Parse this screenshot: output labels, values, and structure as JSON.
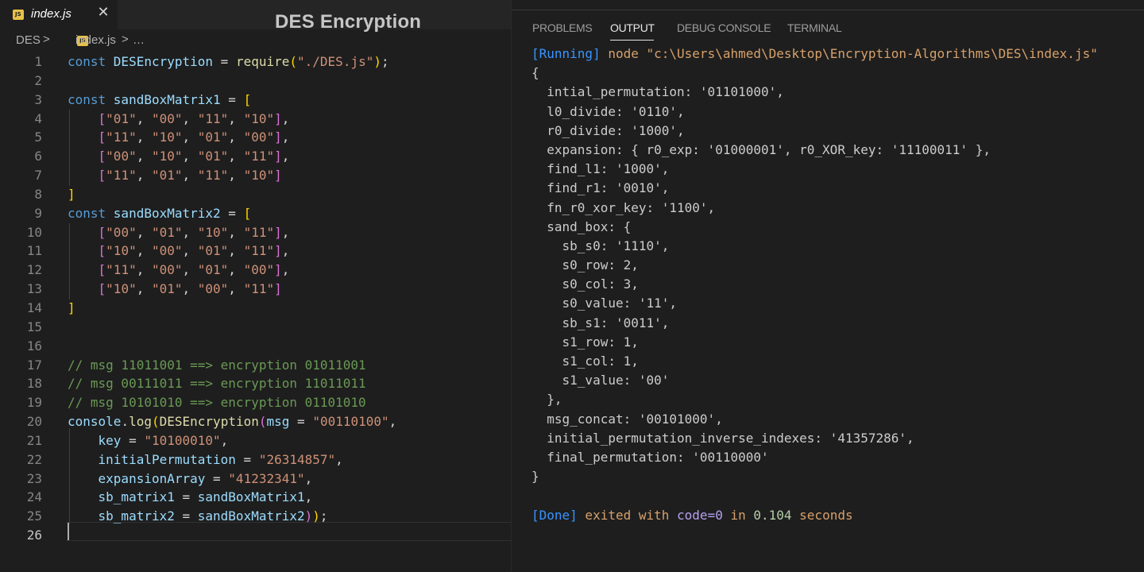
{
  "overlay_title": "DES Encryption",
  "editor": {
    "tab": {
      "label": "index.js",
      "icon": "js-file-icon",
      "close": "✕"
    },
    "breadcrumb": {
      "folder": "DES",
      "sep1": ">",
      "file": "index.js",
      "sep2": ">",
      "more": "…"
    },
    "lines": [
      {
        "n": "1",
        "segs": [
          {
            "t": "const ",
            "c": "k"
          },
          {
            "t": "DESEncryption",
            "c": "v"
          },
          {
            "t": " = ",
            "c": ""
          },
          {
            "t": "require",
            "c": "f"
          },
          {
            "t": "(",
            "c": "b1"
          },
          {
            "t": "\"./DES.js\"",
            "c": "s"
          },
          {
            "t": ")",
            "c": "b1"
          },
          {
            "t": ";",
            "c": ""
          }
        ]
      },
      {
        "n": "2",
        "segs": []
      },
      {
        "n": "3",
        "segs": [
          {
            "t": "const ",
            "c": "k"
          },
          {
            "t": "sandBoxMatrix1",
            "c": "v"
          },
          {
            "t": " = ",
            "c": ""
          },
          {
            "t": "[",
            "c": "b1"
          }
        ]
      },
      {
        "n": "4",
        "segs": [
          {
            "t": "    ",
            "c": ""
          },
          {
            "t": "[",
            "c": "b2"
          },
          {
            "t": "\"01\"",
            "c": "s"
          },
          {
            "t": ", ",
            "c": ""
          },
          {
            "t": "\"00\"",
            "c": "s"
          },
          {
            "t": ", ",
            "c": ""
          },
          {
            "t": "\"11\"",
            "c": "s"
          },
          {
            "t": ", ",
            "c": ""
          },
          {
            "t": "\"10\"",
            "c": "s"
          },
          {
            "t": "]",
            "c": "b2"
          },
          {
            "t": ",",
            "c": ""
          }
        ]
      },
      {
        "n": "5",
        "segs": [
          {
            "t": "    ",
            "c": ""
          },
          {
            "t": "[",
            "c": "b2"
          },
          {
            "t": "\"11\"",
            "c": "s"
          },
          {
            "t": ", ",
            "c": ""
          },
          {
            "t": "\"10\"",
            "c": "s"
          },
          {
            "t": ", ",
            "c": ""
          },
          {
            "t": "\"01\"",
            "c": "s"
          },
          {
            "t": ", ",
            "c": ""
          },
          {
            "t": "\"00\"",
            "c": "s"
          },
          {
            "t": "]",
            "c": "b2"
          },
          {
            "t": ",",
            "c": ""
          }
        ]
      },
      {
        "n": "6",
        "segs": [
          {
            "t": "    ",
            "c": ""
          },
          {
            "t": "[",
            "c": "b2"
          },
          {
            "t": "\"00\"",
            "c": "s"
          },
          {
            "t": ", ",
            "c": ""
          },
          {
            "t": "\"10\"",
            "c": "s"
          },
          {
            "t": ", ",
            "c": ""
          },
          {
            "t": "\"01\"",
            "c": "s"
          },
          {
            "t": ", ",
            "c": ""
          },
          {
            "t": "\"11\"",
            "c": "s"
          },
          {
            "t": "]",
            "c": "b2"
          },
          {
            "t": ",",
            "c": ""
          }
        ]
      },
      {
        "n": "7",
        "segs": [
          {
            "t": "    ",
            "c": ""
          },
          {
            "t": "[",
            "c": "b2"
          },
          {
            "t": "\"11\"",
            "c": "s"
          },
          {
            "t": ", ",
            "c": ""
          },
          {
            "t": "\"01\"",
            "c": "s"
          },
          {
            "t": ", ",
            "c": ""
          },
          {
            "t": "\"11\"",
            "c": "s"
          },
          {
            "t": ", ",
            "c": ""
          },
          {
            "t": "\"10\"",
            "c": "s"
          },
          {
            "t": "]",
            "c": "b2"
          }
        ]
      },
      {
        "n": "8",
        "segs": [
          {
            "t": "]",
            "c": "b1"
          }
        ]
      },
      {
        "n": "9",
        "segs": [
          {
            "t": "const ",
            "c": "k"
          },
          {
            "t": "sandBoxMatrix2",
            "c": "v"
          },
          {
            "t": " = ",
            "c": ""
          },
          {
            "t": "[",
            "c": "b1"
          }
        ]
      },
      {
        "n": "10",
        "segs": [
          {
            "t": "    ",
            "c": ""
          },
          {
            "t": "[",
            "c": "b2"
          },
          {
            "t": "\"00\"",
            "c": "s"
          },
          {
            "t": ", ",
            "c": ""
          },
          {
            "t": "\"01\"",
            "c": "s"
          },
          {
            "t": ", ",
            "c": ""
          },
          {
            "t": "\"10\"",
            "c": "s"
          },
          {
            "t": ", ",
            "c": ""
          },
          {
            "t": "\"11\"",
            "c": "s"
          },
          {
            "t": "]",
            "c": "b2"
          },
          {
            "t": ",",
            "c": ""
          }
        ]
      },
      {
        "n": "11",
        "segs": [
          {
            "t": "    ",
            "c": ""
          },
          {
            "t": "[",
            "c": "b2"
          },
          {
            "t": "\"10\"",
            "c": "s"
          },
          {
            "t": ", ",
            "c": ""
          },
          {
            "t": "\"00\"",
            "c": "s"
          },
          {
            "t": ", ",
            "c": ""
          },
          {
            "t": "\"01\"",
            "c": "s"
          },
          {
            "t": ", ",
            "c": ""
          },
          {
            "t": "\"11\"",
            "c": "s"
          },
          {
            "t": "]",
            "c": "b2"
          },
          {
            "t": ",",
            "c": ""
          }
        ]
      },
      {
        "n": "12",
        "segs": [
          {
            "t": "    ",
            "c": ""
          },
          {
            "t": "[",
            "c": "b2"
          },
          {
            "t": "\"11\"",
            "c": "s"
          },
          {
            "t": ", ",
            "c": ""
          },
          {
            "t": "\"00\"",
            "c": "s"
          },
          {
            "t": ", ",
            "c": ""
          },
          {
            "t": "\"01\"",
            "c": "s"
          },
          {
            "t": ", ",
            "c": ""
          },
          {
            "t": "\"00\"",
            "c": "s"
          },
          {
            "t": "]",
            "c": "b2"
          },
          {
            "t": ",",
            "c": ""
          }
        ]
      },
      {
        "n": "13",
        "segs": [
          {
            "t": "    ",
            "c": ""
          },
          {
            "t": "[",
            "c": "b2"
          },
          {
            "t": "\"10\"",
            "c": "s"
          },
          {
            "t": ", ",
            "c": ""
          },
          {
            "t": "\"01\"",
            "c": "s"
          },
          {
            "t": ", ",
            "c": ""
          },
          {
            "t": "\"00\"",
            "c": "s"
          },
          {
            "t": ", ",
            "c": ""
          },
          {
            "t": "\"11\"",
            "c": "s"
          },
          {
            "t": "]",
            "c": "b2"
          }
        ]
      },
      {
        "n": "14",
        "segs": [
          {
            "t": "]",
            "c": "b1"
          }
        ]
      },
      {
        "n": "15",
        "segs": []
      },
      {
        "n": "16",
        "segs": []
      },
      {
        "n": "17",
        "segs": [
          {
            "t": "// msg 11011001 ==> encryption 01011001",
            "c": "c"
          }
        ]
      },
      {
        "n": "18",
        "segs": [
          {
            "t": "// msg 00111011 ==> encryption 11011011",
            "c": "c"
          }
        ]
      },
      {
        "n": "19",
        "segs": [
          {
            "t": "// msg 10101010 ==> encryption 01101010",
            "c": "c"
          }
        ]
      },
      {
        "n": "20",
        "segs": [
          {
            "t": "console",
            "c": "v"
          },
          {
            "t": ".",
            "c": ""
          },
          {
            "t": "log",
            "c": "f"
          },
          {
            "t": "(",
            "c": "b1"
          },
          {
            "t": "DESEncryption",
            "c": "f"
          },
          {
            "t": "(",
            "c": "b2"
          },
          {
            "t": "msg",
            "c": "v"
          },
          {
            "t": " = ",
            "c": ""
          },
          {
            "t": "\"00110100\"",
            "c": "s"
          },
          {
            "t": ",",
            "c": ""
          }
        ]
      },
      {
        "n": "21",
        "segs": [
          {
            "t": "    ",
            "c": ""
          },
          {
            "t": "key",
            "c": "v"
          },
          {
            "t": " = ",
            "c": ""
          },
          {
            "t": "\"10100010\"",
            "c": "s"
          },
          {
            "t": ",",
            "c": ""
          }
        ]
      },
      {
        "n": "22",
        "segs": [
          {
            "t": "    ",
            "c": ""
          },
          {
            "t": "initialPermutation",
            "c": "v"
          },
          {
            "t": " = ",
            "c": ""
          },
          {
            "t": "\"26314857\"",
            "c": "s"
          },
          {
            "t": ",",
            "c": ""
          }
        ]
      },
      {
        "n": "23",
        "segs": [
          {
            "t": "    ",
            "c": ""
          },
          {
            "t": "expansionArray",
            "c": "v"
          },
          {
            "t": " = ",
            "c": ""
          },
          {
            "t": "\"41232341\"",
            "c": "s"
          },
          {
            "t": ",",
            "c": ""
          }
        ]
      },
      {
        "n": "24",
        "segs": [
          {
            "t": "    ",
            "c": ""
          },
          {
            "t": "sb_matrix1",
            "c": "v"
          },
          {
            "t": " = ",
            "c": ""
          },
          {
            "t": "sandBoxMatrix1",
            "c": "v"
          },
          {
            "t": ",",
            "c": ""
          }
        ]
      },
      {
        "n": "25",
        "segs": [
          {
            "t": "    ",
            "c": ""
          },
          {
            "t": "sb_matrix2",
            "c": "v"
          },
          {
            "t": " = ",
            "c": ""
          },
          {
            "t": "sandBoxMatrix2",
            "c": "v"
          },
          {
            "t": ")",
            "c": "b2"
          },
          {
            "t": ")",
            "c": "b1"
          },
          {
            "t": ";",
            "c": ""
          }
        ]
      },
      {
        "n": "26",
        "segs": []
      }
    ]
  },
  "panel": {
    "tabs": [
      {
        "label": "PROBLEMS",
        "active": false
      },
      {
        "label": "OUTPUT",
        "active": true
      },
      {
        "label": "DEBUG CONSOLE",
        "active": false
      },
      {
        "label": "TERMINAL",
        "active": false
      }
    ],
    "output": [
      [
        {
          "t": "[Running]",
          "c": "blue"
        },
        {
          "t": " node \"c:\\Users\\ahmed\\Desktop\\Encryption-Algorithms\\DES\\index.js\"",
          "c": "orange"
        }
      ],
      [
        {
          "t": "{",
          "c": ""
        }
      ],
      [
        {
          "t": "  intial_permutation: '01101000',",
          "c": ""
        }
      ],
      [
        {
          "t": "  l0_divide: '0110',",
          "c": ""
        }
      ],
      [
        {
          "t": "  r0_divide: '1000',",
          "c": ""
        }
      ],
      [
        {
          "t": "  expansion: { r0_exp: '01000001', r0_XOR_key: '11100011' },",
          "c": ""
        }
      ],
      [
        {
          "t": "  find_l1: '1000',",
          "c": ""
        }
      ],
      [
        {
          "t": "  find_r1: '0010',",
          "c": ""
        }
      ],
      [
        {
          "t": "  fn_r0_xor_key: '1100',",
          "c": ""
        }
      ],
      [
        {
          "t": "  sand_box: {",
          "c": ""
        }
      ],
      [
        {
          "t": "    sb_s0: '1110',",
          "c": ""
        }
      ],
      [
        {
          "t": "    s0_row: 2,",
          "c": ""
        }
      ],
      [
        {
          "t": "    s0_col: 3,",
          "c": ""
        }
      ],
      [
        {
          "t": "    s0_value: '11',",
          "c": ""
        }
      ],
      [
        {
          "t": "    sb_s1: '0011',",
          "c": ""
        }
      ],
      [
        {
          "t": "    s1_row: 1,",
          "c": ""
        }
      ],
      [
        {
          "t": "    s1_col: 1,",
          "c": ""
        }
      ],
      [
        {
          "t": "    s1_value: '00'",
          "c": ""
        }
      ],
      [
        {
          "t": "  },",
          "c": ""
        }
      ],
      [
        {
          "t": "  msg_concat: '00101000',",
          "c": ""
        }
      ],
      [
        {
          "t": "  initial_permutation_inverse_indexes: '41357286',",
          "c": ""
        }
      ],
      [
        {
          "t": "  final_permutation: '00110000'",
          "c": ""
        }
      ],
      [
        {
          "t": "}",
          "c": ""
        }
      ],
      [],
      [
        {
          "t": "[Done]",
          "c": "blue"
        },
        {
          "t": " exited with ",
          "c": "orange"
        },
        {
          "t": "code=0",
          "c": "lavender"
        },
        {
          "t": " in ",
          "c": "orange"
        },
        {
          "t": "0.104",
          "c": "green"
        },
        {
          "t": " seconds",
          "c": "orange"
        }
      ]
    ]
  },
  "colors": {
    "background": "#1e1e1e",
    "keyword": "#569cd6",
    "string": "#ce9178",
    "comment": "#6a9955",
    "running": "#3794ff",
    "path": "#d7a16b"
  }
}
